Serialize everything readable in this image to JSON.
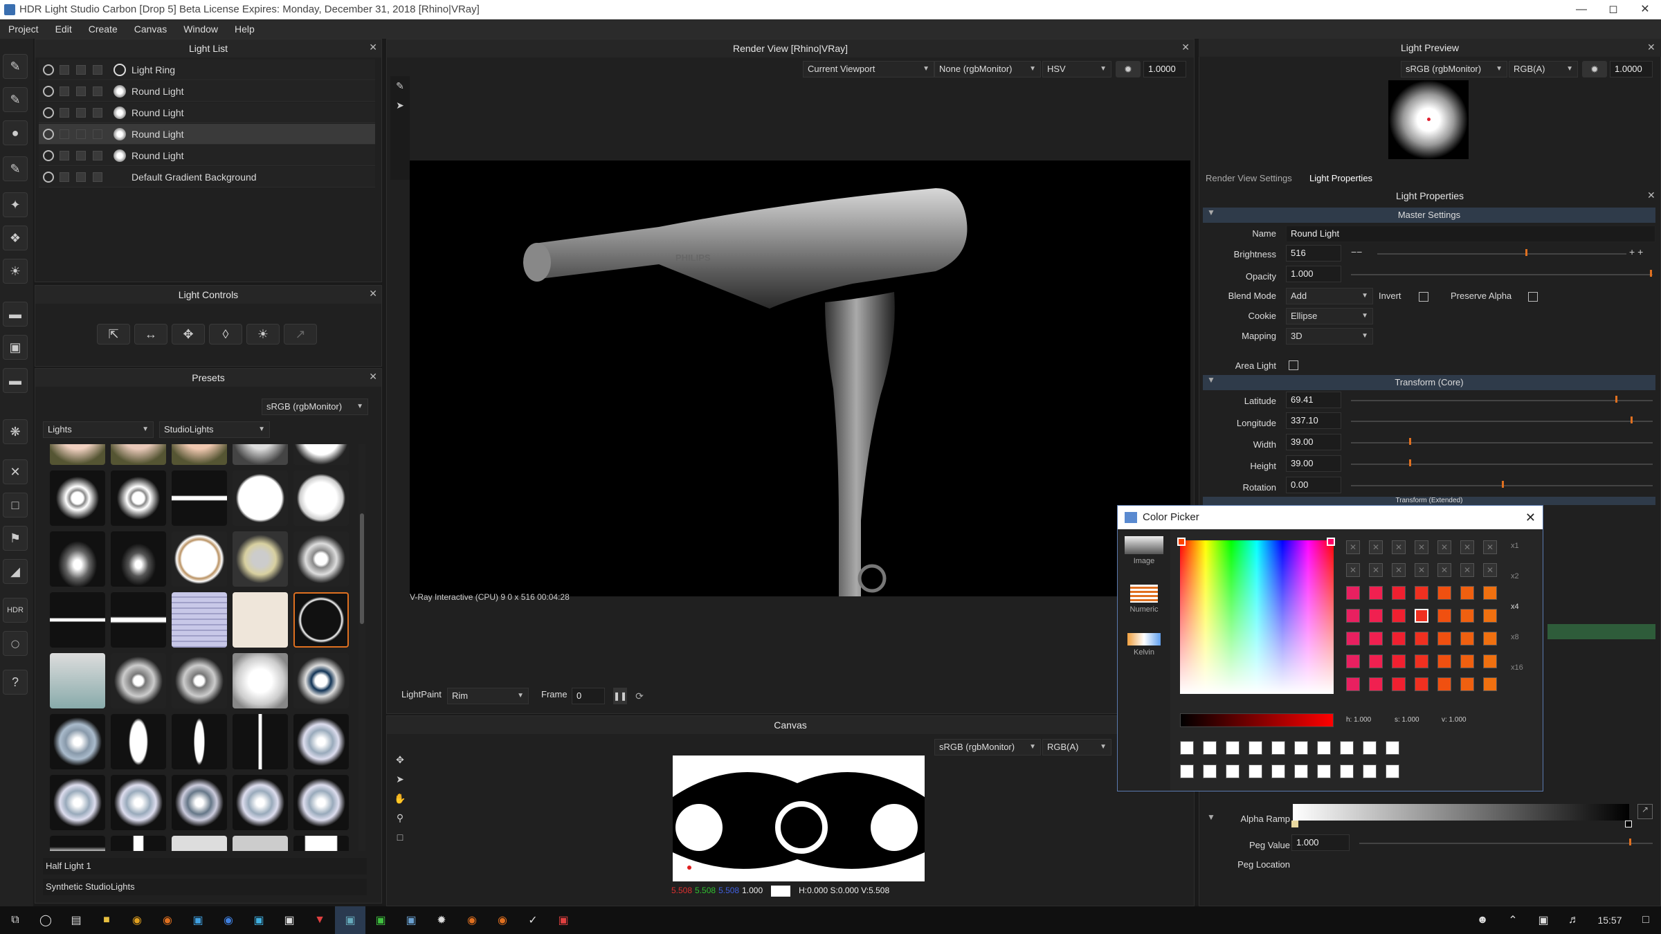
{
  "window": {
    "title": "HDR Light Studio Carbon [Drop 5] Beta License Expires: Monday, December 31, 2018  [Rhino|VRay]"
  },
  "menu": [
    "Project",
    "Edit",
    "Create",
    "Canvas",
    "Window",
    "Help"
  ],
  "light_list": {
    "title": "Light List",
    "items": [
      "Light Ring",
      "Round Light",
      "Round Light",
      "Round Light",
      "Round Light",
      "Default Gradient Background"
    ]
  },
  "light_controls": {
    "title": "Light Controls"
  },
  "presets": {
    "title": "Presets",
    "colorspace": "sRGB (rgbMonitor)",
    "category": "Lights",
    "collection": "StudioLights",
    "selected_name": "Half Light 1",
    "footer": "Synthetic StudioLights"
  },
  "render_view": {
    "title": "Render View [Rhino|VRay]",
    "viewport": "Current Viewport",
    "lut": "None (rgbMonitor)",
    "mode": "HSV",
    "exposure": "1.0000",
    "status": "V-Ray Interactive (CPU)   9 0 x 516      00:04:28",
    "brand": "PHILIPS",
    "lightpaint_label": "LightPaint",
    "lightpaint_value": "Rim",
    "frame_label": "Frame",
    "frame_value": "0"
  },
  "canvas": {
    "title": "Canvas",
    "colorspace": "sRGB (rgbMonitor)",
    "channel": "RGB(A)",
    "r": "5.508",
    "g": "5.508",
    "b": "5.508",
    "a": "1.000",
    "hsv": "H:0.000 S:0.000 V:5.508"
  },
  "light_preview": {
    "title": "Light Preview",
    "colorspace": "sRGB (rgbMonitor)",
    "channel": "RGB(A)",
    "exposure": "1.0000"
  },
  "tabs": [
    "Render View Settings",
    "Light Properties"
  ],
  "light_properties": {
    "title": "Light Properties",
    "master": "Master Settings",
    "name_label": "Name",
    "name": "Round Light",
    "brightness_label": "Brightness",
    "brightness": "516",
    "opacity_label": "Opacity",
    "opacity": "1.000",
    "blend_label": "Blend Mode",
    "blend": "Add",
    "invert_label": "Invert",
    "preserve_label": "Preserve Alpha",
    "cookie_label": "Cookie",
    "cookie": "Ellipse",
    "mapping_label": "Mapping",
    "mapping": "3D",
    "area_label": "Area Light",
    "transform": "Transform (Core)",
    "lat_label": "Latitude",
    "lat": "69.41",
    "lon_label": "Longitude",
    "lon": "337.10",
    "w_label": "Width",
    "w": "39.00",
    "h_label": "Height",
    "h": "39.00",
    "rot_label": "Rotation",
    "rot": "0.00",
    "transform_ext": "Transform (Extended)",
    "alpha_label": "Alpha Ramp",
    "peg_label": "Peg Value",
    "peg": "1.000",
    "pegloc_label": "Peg Location"
  },
  "color_picker": {
    "title": "Color Picker",
    "modes": [
      "Image",
      "Numeric",
      "Kelvin"
    ],
    "h": "h: 1.000",
    "s": "s: 1.000",
    "v": "v: 1.000",
    "zoom": [
      "x1",
      "x2",
      "x4",
      "x8",
      "x16"
    ]
  },
  "taskbar": {
    "time": "15:57"
  }
}
